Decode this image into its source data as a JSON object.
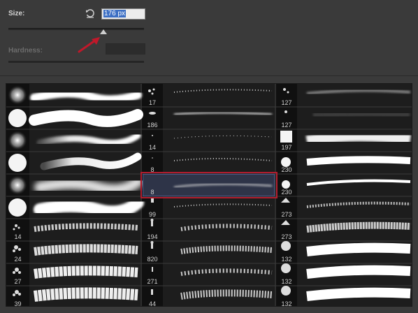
{
  "size": {
    "label": "Size:",
    "value": "176 px",
    "slider_level_fraction": 0.69
  },
  "hardness": {
    "label": "Hardness:",
    "value": ""
  },
  "brushes": {
    "col1": [
      {
        "count": ""
      },
      {
        "count": ""
      },
      {
        "count": ""
      },
      {
        "count": ""
      },
      {
        "count": ""
      },
      {
        "count": ""
      },
      {
        "count": "14"
      },
      {
        "count": "24"
      },
      {
        "count": "27"
      },
      {
        "count": "39"
      }
    ],
    "col2": [
      {
        "count": "17"
      },
      {
        "count": "186"
      },
      {
        "count": "14"
      },
      {
        "count": "8"
      },
      {
        "count": "8"
      },
      {
        "count": "99"
      },
      {
        "count": "194"
      },
      {
        "count": "820"
      },
      {
        "count": "271"
      },
      {
        "count": "44"
      }
    ],
    "col3": [
      {
        "count": "127"
      },
      {
        "count": "127"
      },
      {
        "count": "197"
      },
      {
        "count": "230"
      },
      {
        "count": "230"
      },
      {
        "count": "273"
      },
      {
        "count": "273"
      },
      {
        "count": "132"
      },
      {
        "count": "132"
      },
      {
        "count": "132"
      }
    ]
  },
  "selected_brush": {
    "column": 2,
    "row": 5,
    "count": "8"
  },
  "colors": {
    "panel_bg": "#3a3a3a",
    "grid_bg": "#222222",
    "highlight": "#b01c2e",
    "arrow": "#c0182a",
    "selection": "#3c6fc4"
  }
}
